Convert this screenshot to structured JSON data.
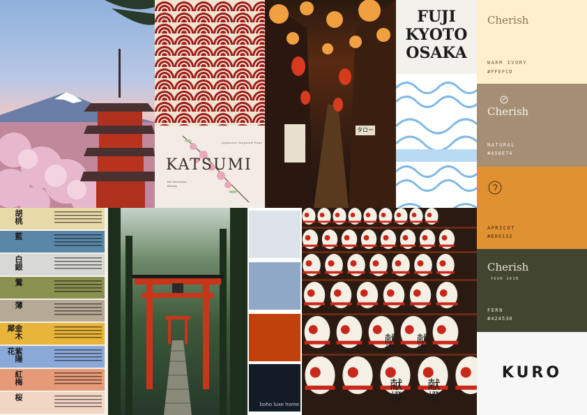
{
  "katsumi": {
    "title": "KATSUMI",
    "tagline": "Japanese Inspired Font",
    "side_text": "for Victorious Beauty"
  },
  "alley_sign": "タロー",
  "kyoto": {
    "line1": "FUJI",
    "line2": "KYOTO",
    "line3": "OSAKA"
  },
  "palette": {
    "swatches": [
      {
        "brand": "Cherish",
        "name": "WARM IVORY",
        "hex": "#FFEFCD",
        "color": "#FFEFCD",
        "text_color": "#6b5b3e"
      },
      {
        "brand": "Cherish",
        "name": "NATURAL",
        "hex": "#A58E74",
        "color": "#A58E74",
        "text_color": "#f7f1e8"
      },
      {
        "brand": "",
        "name": "APRICOT",
        "hex": "#E09132",
        "color": "#E09132",
        "text_color": "#4a2a0a"
      },
      {
        "brand": "Cherish",
        "name": "FERN",
        "hex": "#424530",
        "color": "#424530",
        "text_color": "#e8e6d8",
        "sub": "YOUR SKIN"
      }
    ]
  },
  "kuro": {
    "logo": "KURO"
  },
  "color_names": [
    {
      "kanji": "胡桃",
      "color": "#e8d9a8"
    },
    {
      "kanji": "藍",
      "color": "#5a86a8"
    },
    {
      "kanji": "白銀",
      "color": "#d8d8d4"
    },
    {
      "kanji": "鶯",
      "color": "#8a9050"
    },
    {
      "kanji": "薄",
      "color": "#b6aa96"
    },
    {
      "kanji": "金木犀",
      "color": "#e9b43a"
    },
    {
      "kanji": "紫陽花",
      "color": "#8aa8d8"
    },
    {
      "kanji": "紅梅",
      "color": "#e69a78"
    },
    {
      "kanji": "桜",
      "color": "#f2d6c4"
    }
  ],
  "palette2": {
    "colors": [
      "#dde3e8",
      "#8fa8c6",
      "#c1410c",
      "#131c26"
    ],
    "brand": "boho luxe home"
  },
  "lantern_kanji": "献燈",
  "icons": [
    "cherish-leaf-icon",
    "apricot-symbol-icon"
  ]
}
